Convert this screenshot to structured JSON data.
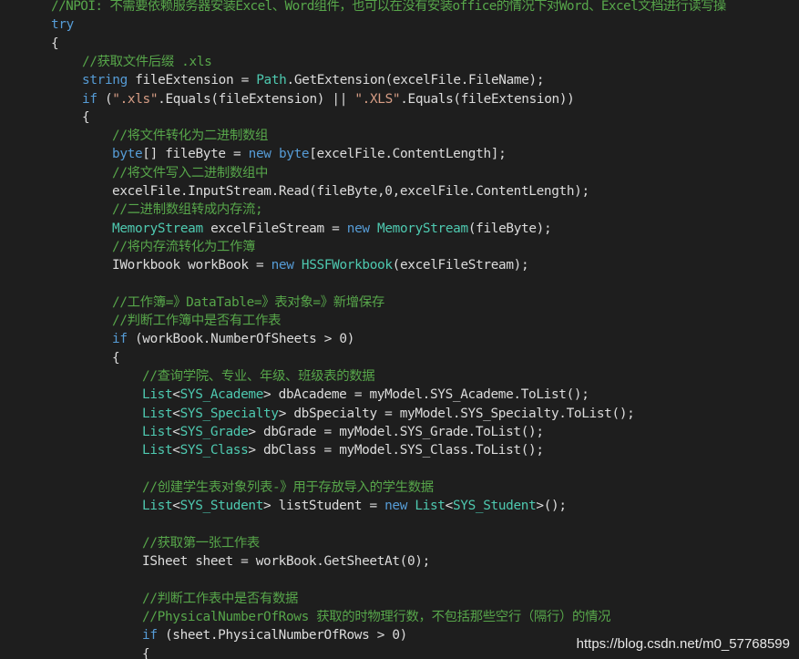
{
  "editor": {
    "background": "#1e1e1e",
    "colors": {
      "keyword": "#569cd6",
      "type": "#4ec9b0",
      "comment": "#57a64a",
      "string": "#d69d85",
      "plain": "#dcdcdc"
    },
    "lines": [
      {
        "indent": 56,
        "tokens": [
          [
            "cm",
            "//NPOI: 不需要依赖服务器安装Excel、Word组件，也可以在没有安装office的情况下对Word、Excel文档进行读写操"
          ]
        ]
      },
      {
        "indent": 56,
        "tokens": [
          [
            "kw",
            "try"
          ]
        ]
      },
      {
        "indent": 56,
        "tokens": [
          [
            "pl",
            "{"
          ]
        ]
      },
      {
        "indent": 90,
        "tokens": [
          [
            "cm",
            "//获取文件后缀 .xls"
          ]
        ]
      },
      {
        "indent": 90,
        "tokens": [
          [
            "kw",
            "string"
          ],
          [
            "pl",
            " fileExtension = "
          ],
          [
            "type",
            "Path"
          ],
          [
            "pl",
            ".GetExtension(excelFile.FileName);"
          ]
        ]
      },
      {
        "indent": 90,
        "tokens": [
          [
            "kw",
            "if"
          ],
          [
            "pl",
            " ("
          ],
          [
            "str",
            "\".xls\""
          ],
          [
            "pl",
            ".Equals(fileExtension) || "
          ],
          [
            "str",
            "\".XLS\""
          ],
          [
            "pl",
            ".Equals(fileExtension))"
          ]
        ]
      },
      {
        "indent": 90,
        "tokens": [
          [
            "pl",
            "{"
          ]
        ]
      },
      {
        "indent": 123,
        "tokens": [
          [
            "cm",
            "//将文件转化为二进制数组"
          ]
        ]
      },
      {
        "indent": 123,
        "tokens": [
          [
            "kw",
            "byte"
          ],
          [
            "pl",
            "[] fileByte = "
          ],
          [
            "kw",
            "new"
          ],
          [
            "pl",
            " "
          ],
          [
            "kw",
            "byte"
          ],
          [
            "pl",
            "[excelFile.ContentLength];"
          ]
        ]
      },
      {
        "indent": 123,
        "tokens": [
          [
            "cm",
            "//将文件写入二进制数组中"
          ]
        ]
      },
      {
        "indent": 123,
        "tokens": [
          [
            "pl",
            "excelFile.InputStream.Read(fileByte,0,excelFile.ContentLength);"
          ]
        ]
      },
      {
        "indent": 123,
        "tokens": [
          [
            "cm",
            "//二进制数组转成内存流;"
          ]
        ]
      },
      {
        "indent": 123,
        "tokens": [
          [
            "type",
            "MemoryStream"
          ],
          [
            "pl",
            " excelFileStream = "
          ],
          [
            "kw",
            "new"
          ],
          [
            "pl",
            " "
          ],
          [
            "type",
            "MemoryStream"
          ],
          [
            "pl",
            "(fileByte);"
          ]
        ]
      },
      {
        "indent": 123,
        "tokens": [
          [
            "cm",
            "//将内存流转化为工作簿"
          ]
        ]
      },
      {
        "indent": 123,
        "tokens": [
          [
            "pl",
            "IWorkbook workBook = "
          ],
          [
            "kw",
            "new"
          ],
          [
            "pl",
            " "
          ],
          [
            "type",
            "HSSFWorkbook"
          ],
          [
            "pl",
            "(excelFileStream);"
          ]
        ]
      },
      {
        "indent": 123,
        "tokens": []
      },
      {
        "indent": 123,
        "tokens": [
          [
            "cm",
            "//工作簿=》DataTable=》表对象=》新增保存"
          ]
        ]
      },
      {
        "indent": 123,
        "tokens": [
          [
            "cm",
            "//判断工作簿中是否有工作表"
          ]
        ]
      },
      {
        "indent": 123,
        "tokens": [
          [
            "kw",
            "if"
          ],
          [
            "pl",
            " (workBook.NumberOfSheets > 0)"
          ]
        ]
      },
      {
        "indent": 123,
        "tokens": [
          [
            "pl",
            "{"
          ]
        ]
      },
      {
        "indent": 156,
        "tokens": [
          [
            "cm",
            "//查询学院、专业、年级、班级表的数据"
          ]
        ]
      },
      {
        "indent": 156,
        "tokens": [
          [
            "type",
            "List"
          ],
          [
            "pl",
            "<"
          ],
          [
            "type",
            "SYS_Academe"
          ],
          [
            "pl",
            "> dbAcademe = myModel.SYS_Academe.ToList();"
          ]
        ]
      },
      {
        "indent": 156,
        "tokens": [
          [
            "type",
            "List"
          ],
          [
            "pl",
            "<"
          ],
          [
            "type",
            "SYS_Specialty"
          ],
          [
            "pl",
            "> dbSpecialty = myModel.SYS_Specialty.ToList();"
          ]
        ]
      },
      {
        "indent": 156,
        "tokens": [
          [
            "type",
            "List"
          ],
          [
            "pl",
            "<"
          ],
          [
            "type",
            "SYS_Grade"
          ],
          [
            "pl",
            "> dbGrade = myModel.SYS_Grade.ToList();"
          ]
        ]
      },
      {
        "indent": 156,
        "tokens": [
          [
            "type",
            "List"
          ],
          [
            "pl",
            "<"
          ],
          [
            "type",
            "SYS_Class"
          ],
          [
            "pl",
            "> dbClass = myModel.SYS_Class.ToList();"
          ]
        ]
      },
      {
        "indent": 156,
        "tokens": []
      },
      {
        "indent": 156,
        "tokens": [
          [
            "cm",
            "//创建学生表对象列表-》用于存放导入的学生数据"
          ]
        ]
      },
      {
        "indent": 156,
        "tokens": [
          [
            "type",
            "List"
          ],
          [
            "pl",
            "<"
          ],
          [
            "type",
            "SYS_Student"
          ],
          [
            "pl",
            "> listStudent = "
          ],
          [
            "kw",
            "new"
          ],
          [
            "pl",
            " "
          ],
          [
            "type",
            "List"
          ],
          [
            "pl",
            "<"
          ],
          [
            "type",
            "SYS_Student"
          ],
          [
            "pl",
            ">();"
          ]
        ]
      },
      {
        "indent": 156,
        "tokens": []
      },
      {
        "indent": 156,
        "tokens": [
          [
            "cm",
            "//获取第一张工作表"
          ]
        ]
      },
      {
        "indent": 156,
        "tokens": [
          [
            "pl",
            "ISheet sheet = workBook.GetSheetAt(0);"
          ]
        ]
      },
      {
        "indent": 156,
        "tokens": []
      },
      {
        "indent": 156,
        "tokens": [
          [
            "cm",
            "//判断工作表中是否有数据"
          ]
        ]
      },
      {
        "indent": 156,
        "tokens": [
          [
            "cm",
            "//PhysicalNumberOfRows 获取的时物理行数，不包括那些空行（隔行）的情况"
          ]
        ]
      },
      {
        "indent": 156,
        "tokens": [
          [
            "kw",
            "if"
          ],
          [
            "pl",
            " (sheet.PhysicalNumberOfRows > 0)"
          ]
        ]
      },
      {
        "indent": 156,
        "tokens": [
          [
            "pl",
            "{"
          ]
        ]
      }
    ]
  },
  "watermark": "https://blog.csdn.net/m0_57768599"
}
